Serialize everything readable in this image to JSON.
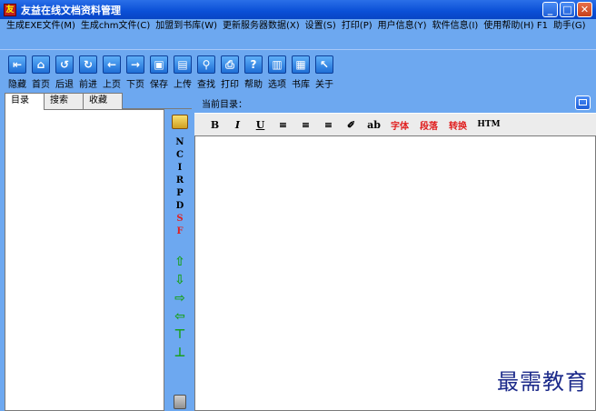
{
  "window": {
    "title": "友益在线文档资料管理",
    "logo_text": "友"
  },
  "menu": {
    "items": [
      "生成EXE文件(M)",
      "生成chm文件(C)",
      "加盟到书库(W)",
      "更新服务器数据(X)",
      "设置(S)",
      "打印(P)",
      "用户信息(Y)",
      "软件信息(I)",
      "使用帮助(H) F1",
      "助手(G)"
    ]
  },
  "toolbar": {
    "items": [
      {
        "label": "隐藏",
        "icon": "hide-icon"
      },
      {
        "label": "首页",
        "icon": "home-icon"
      },
      {
        "label": "后退",
        "icon": "back-icon"
      },
      {
        "label": "前进",
        "icon": "forward-icon"
      },
      {
        "label": "上页",
        "icon": "prev-page-icon"
      },
      {
        "label": "下页",
        "icon": "next-page-icon"
      },
      {
        "label": "保存",
        "icon": "save-icon"
      },
      {
        "label": "上传",
        "icon": "upload-icon"
      },
      {
        "label": "查找",
        "icon": "find-icon"
      },
      {
        "label": "打印",
        "icon": "print-icon"
      },
      {
        "label": "帮助",
        "icon": "help-icon"
      },
      {
        "label": "选项",
        "icon": "options-icon"
      },
      {
        "label": "书库",
        "icon": "library-icon"
      },
      {
        "label": "关于",
        "icon": "about-icon"
      }
    ]
  },
  "left_tabs": [
    "目录",
    "搜索",
    "收藏"
  ],
  "side_tools": {
    "letters": [
      "N",
      "C",
      "I",
      "R",
      "P",
      "D",
      "S",
      "F"
    ],
    "red_letters": [
      "S",
      "F"
    ]
  },
  "right_panel": {
    "dir_label": "当前目录：",
    "format_buttons": [
      "B",
      "I",
      "U",
      "≡",
      "≡",
      "≡",
      "✐",
      "ab"
    ],
    "format_text": [
      "字体",
      "段落",
      "转换"
    ],
    "html_label": "HTM"
  },
  "watermark": "最需教育"
}
